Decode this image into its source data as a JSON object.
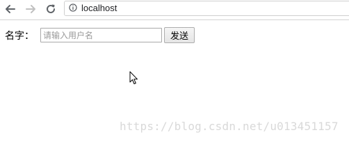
{
  "browser": {
    "url": "localhost",
    "icons": {
      "back": "back-arrow-icon",
      "forward": "forward-arrow-icon",
      "reload": "reload-icon",
      "site_info": "info-icon"
    }
  },
  "form": {
    "label": "名字：",
    "input_placeholder": "请输入用户名",
    "input_value": "",
    "send_label": "发送"
  },
  "overlay": {
    "watermark": "https://blog.csdn.net/u013451157"
  },
  "colors": {
    "toolbar_icon": "#5f6368",
    "disabled_icon": "#c0c0c0",
    "watermark": "#d9d9d9"
  }
}
